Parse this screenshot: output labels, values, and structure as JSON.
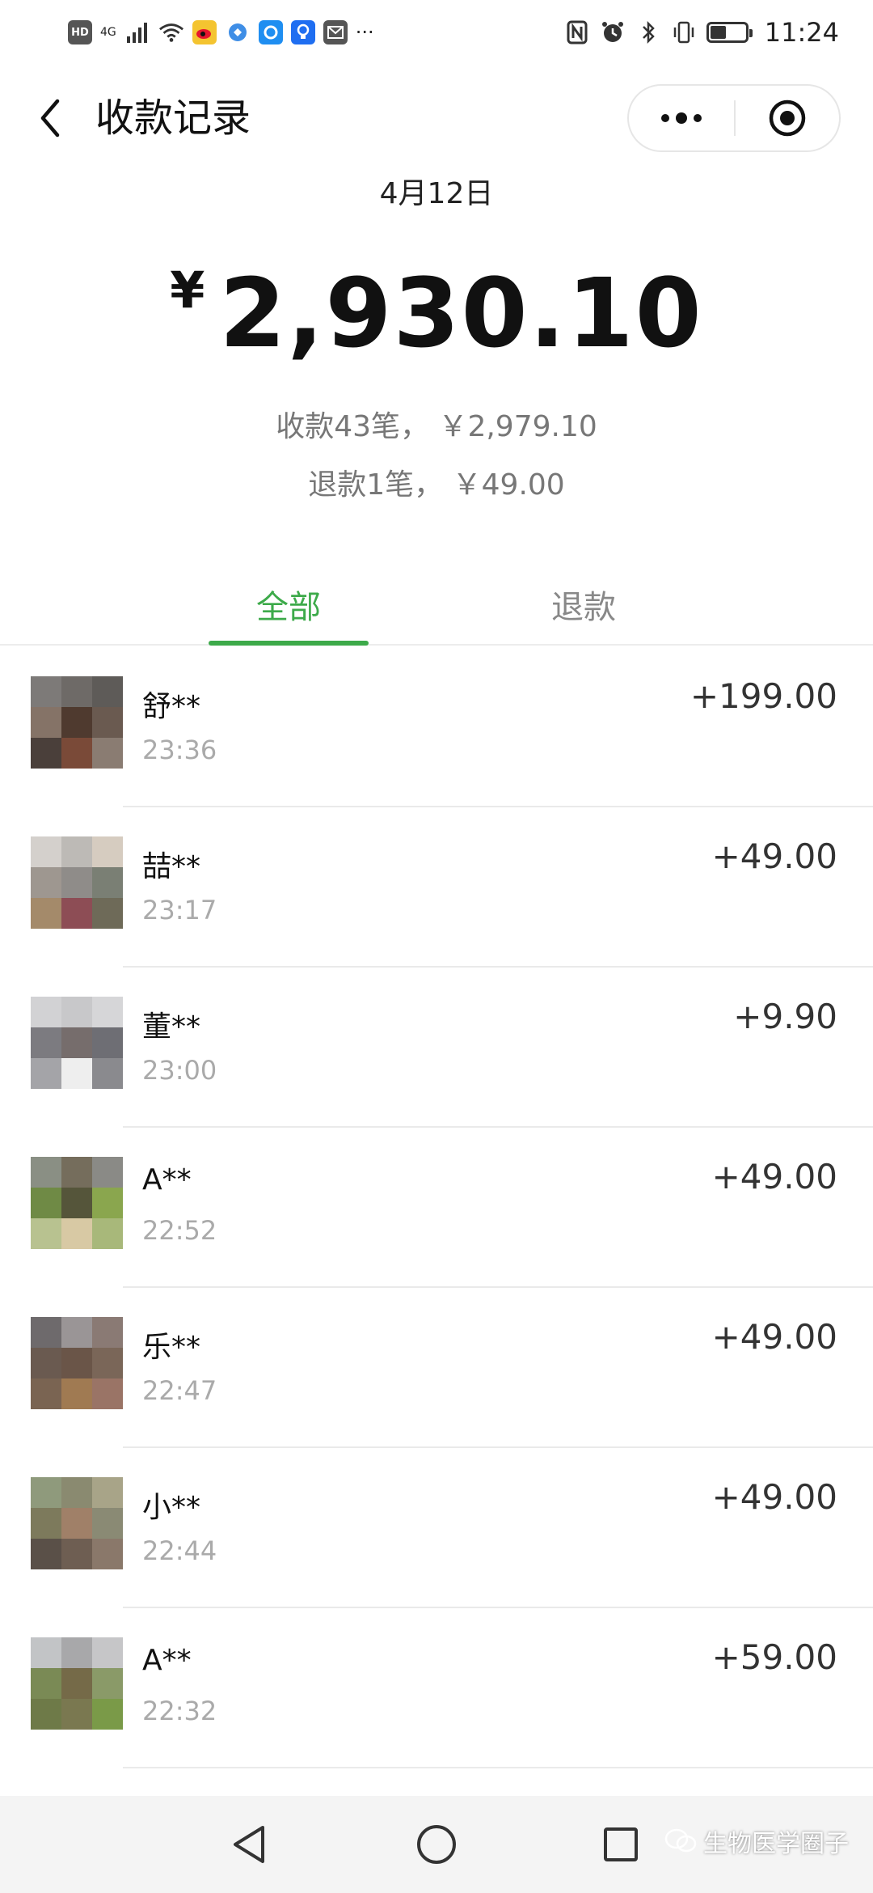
{
  "status_bar": {
    "network": "4G",
    "hd_badge": "HD",
    "time": "11:24",
    "more_dots": "···",
    "battery_level": 0.45,
    "left_icons": [
      "hd-icon",
      "signal-icon",
      "wifi-icon",
      "weibo-icon",
      "app-icon",
      "app-icon",
      "bulb-icon",
      "mail-icon"
    ],
    "right_icons": [
      "nfc-icon",
      "alarm-icon",
      "bluetooth-icon",
      "vibrate-icon",
      "battery-icon"
    ]
  },
  "header": {
    "title": "收款记录"
  },
  "summary": {
    "date": "4月12日",
    "currency": "¥",
    "total": "2,930.10",
    "received_line": "收款43笔， ￥2,979.10",
    "refund_line": "退款1笔， ￥49.00"
  },
  "tabs": [
    {
      "label": "全部",
      "active": true
    },
    {
      "label": "退款",
      "active": false
    }
  ],
  "transactions": [
    {
      "name": "舒**",
      "time": "23:36",
      "amount": "+199.00",
      "colors": [
        "#7d7a78",
        "#6e6a67",
        "#5e5b58",
        "#857367",
        "#4f3a2f",
        "#6a5a50",
        "#4a3f3a",
        "#7a4a38",
        "#8a7c72"
      ]
    },
    {
      "name": "喆**",
      "time": "23:17",
      "amount": "+49.00",
      "colors": [
        "#d4d0cc",
        "#bdbab6",
        "#d6ccc0",
        "#9e9790",
        "#8f8c89",
        "#7a7f74",
        "#a48a6a",
        "#8d4d55",
        "#6e6a58",
        "#ece2d8",
        "#e6dcd6",
        "#e2e0da"
      ]
    },
    {
      "name": "董**",
      "time": "23:00",
      "amount": "+9.90",
      "colors": [
        "#d2d2d4",
        "#c8c8ca",
        "#d6d6d8",
        "#7c7b80",
        "#766d6c",
        "#6e6e74",
        "#a4a4a8",
        "#eeeeee",
        "#8a8a8e",
        "#dddddd",
        "#f2f2f2",
        "#cfcfd1"
      ]
    },
    {
      "name": "A**",
      "time": "22:52",
      "amount": "+49.00",
      "colors": [
        "#8a8f84",
        "#756d5c",
        "#8a8a86",
        "#6f8a45",
        "#55553a",
        "#8aa64e",
        "#b8c290",
        "#d8c9a4",
        "#a8b87a"
      ]
    },
    {
      "name": "乐**",
      "time": "22:47",
      "amount": "+49.00",
      "colors": [
        "#6e6a6c",
        "#9a9596",
        "#8a7a74",
        "#6a5a50",
        "#6a5548",
        "#7a6658",
        "#7a6452",
        "#a07a52",
        "#9a7466"
      ]
    },
    {
      "name": "小**",
      "time": "22:44",
      "amount": "+49.00",
      "colors": [
        "#8f9a7c",
        "#8a8a70",
        "#a8a488",
        "#7d7a5c",
        "#a08068",
        "#8a8a74",
        "#5a5048",
        "#6e5e52",
        "#8a786a"
      ]
    },
    {
      "name": "A**",
      "time": "22:32",
      "amount": "+59.00",
      "colors": [
        "#c2c4c6",
        "#a8a8aa",
        "#c6c6c8",
        "#7a8a55",
        "#756a48",
        "#8a9a68",
        "#6e7a48",
        "#7a7850",
        "#7a9a48"
      ]
    }
  ],
  "watermark": {
    "text": "生物医学圈子"
  },
  "colors": {
    "accent_green": "#3daa4a",
    "text_primary": "#111111",
    "text_secondary": "#777777",
    "text_muted": "#aaaaaa"
  }
}
